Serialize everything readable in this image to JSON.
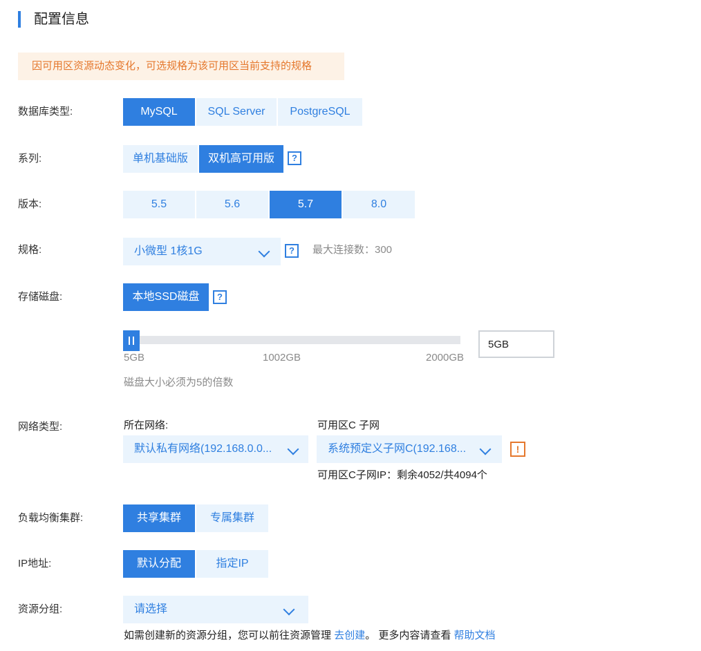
{
  "title": "配置信息",
  "notice": "因可用区资源动态变化，可选规格为该可用区当前支持的规格",
  "db_type": {
    "label": "数据库类型:",
    "options": [
      "MySQL",
      "SQL Server",
      "PostgreSQL"
    ],
    "selected": "MySQL"
  },
  "series": {
    "label": "系列:",
    "options": [
      "单机基础版",
      "双机高可用版"
    ],
    "selected": "双机高可用版",
    "help": "?"
  },
  "version": {
    "label": "版本:",
    "options": [
      "5.5",
      "5.6",
      "5.7",
      "8.0"
    ],
    "selected": "5.7"
  },
  "spec": {
    "label": "规格:",
    "value": "小微型 1核1G",
    "help": "?",
    "max_conn": "最大连接数：300"
  },
  "storage": {
    "label": "存储磁盘:",
    "type": "本地SSD磁盘",
    "help": "?",
    "slider": {
      "min": "5GB",
      "mid": "1002GB",
      "max": "2000GB",
      "value": 5,
      "range": [
        5,
        2000
      ]
    },
    "input_value": "5GB",
    "hint": "磁盘大小必须为5的倍数"
  },
  "network": {
    "label": "网络类型:",
    "vpc_label": "所在网络:",
    "vpc_value": "默认私有网络(192.168.0.0...",
    "subnet_label": "可用区C 子网",
    "subnet_value": "系统预定义子网C(192.168...",
    "warn": "!",
    "ip_info": "可用区C子网IP：剩余4052/共4094个"
  },
  "lb_cluster": {
    "label": "负载均衡集群:",
    "options": [
      "共享集群",
      "专属集群"
    ],
    "selected": "共享集群"
  },
  "ip_address": {
    "label": "IP地址:",
    "options": [
      "默认分配",
      "指定IP"
    ],
    "selected": "默认分配"
  },
  "resource_group": {
    "label": "资源分组:",
    "placeholder": "请选择",
    "hint_prefix": "如需创建新的资源分组，您可以前往资源管理",
    "create_link": "去创建",
    "hint_middle": "。 更多内容请查看",
    "doc_link": "帮助文档"
  },
  "colors": {
    "accent": "#2f7fe0",
    "accent_light": "#eaf4fd",
    "warning": "#e5782d",
    "notice_bg": "#fdf2e6"
  }
}
